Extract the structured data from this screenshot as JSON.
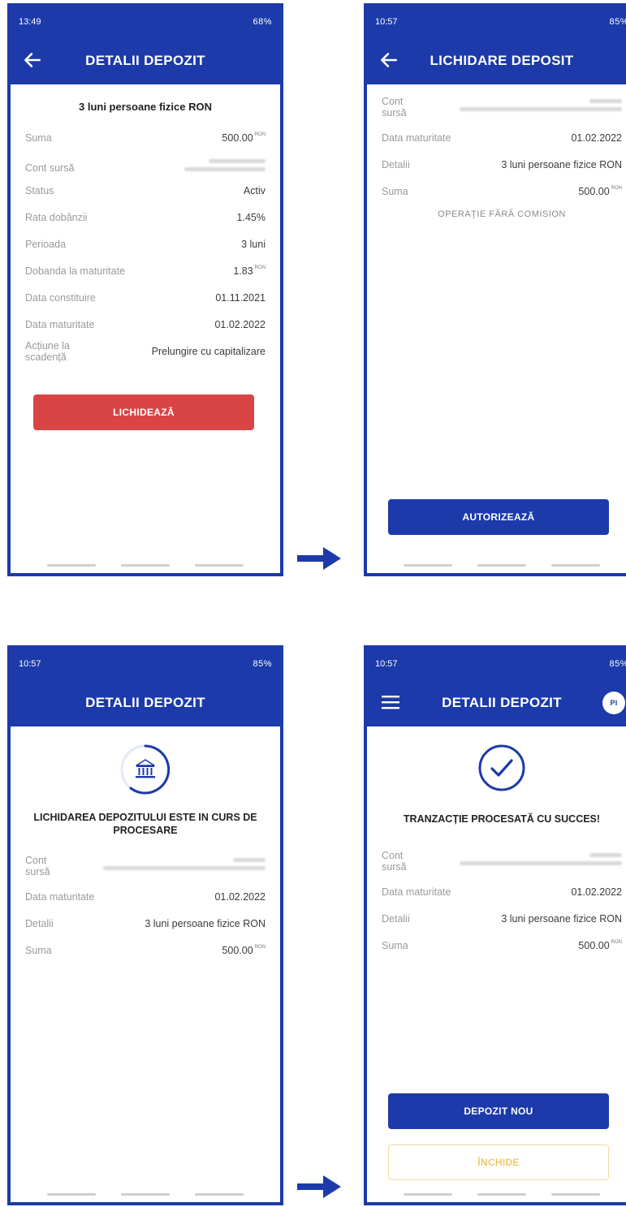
{
  "screen1": {
    "status": {
      "time": "13:49",
      "battery": "68%"
    },
    "header": {
      "title": "DETALII DEPOZIT"
    },
    "product": "3 luni persoane fizice RON",
    "rows": [
      {
        "label": "Suma",
        "value": "500.00",
        "currency": "RON"
      },
      {
        "label": "Cont sursă"
      },
      {
        "label": "Status",
        "value": "Activ"
      },
      {
        "label": "Rata dobânzii",
        "value": "1.45%"
      },
      {
        "label": "Perioada",
        "value": "3 luni"
      },
      {
        "label": "Dobanda la maturitate",
        "value": "1.83",
        "currency": "RON"
      },
      {
        "label": "Data constituire",
        "value": "01.11.2021"
      },
      {
        "label": "Data maturitate",
        "value": "01.02.2022"
      },
      {
        "label": "Acțiune la scadență",
        "value": "Prelungire cu capitalizare"
      }
    ],
    "button": "LICHIDEAZĂ"
  },
  "screen2": {
    "status": {
      "time": "10:57",
      "battery": "85%"
    },
    "header": {
      "title": "LICHIDARE DEPOSIT"
    },
    "rows": [
      {
        "label": "Cont sursă"
      },
      {
        "label": "Data maturitate",
        "value": "01.02.2022"
      },
      {
        "label": "Detalii",
        "value": "3 luni persoane fizice RON"
      },
      {
        "label": "Suma",
        "value": "500.00",
        "currency": "RON"
      }
    ],
    "note": "OPERAȚIE FĂRĂ COMISION",
    "button": "AUTORIZEAZĂ"
  },
  "screen3": {
    "status": {
      "time": "10:57",
      "battery": "85%"
    },
    "header": {
      "title": "DETALII DEPOZIT"
    },
    "heading": "LICHIDAREA DEPOZITULUI ESTE IN CURS DE PROCESARE",
    "rows": [
      {
        "label": "Cont sursă"
      },
      {
        "label": "Data maturitate",
        "value": "01.02.2022"
      },
      {
        "label": "Detalii",
        "value": "3 luni persoane fizice RON"
      },
      {
        "label": "Suma",
        "value": "500.00",
        "currency": "RON"
      }
    ]
  },
  "screen4": {
    "status": {
      "time": "10:57",
      "battery": "85%"
    },
    "header": {
      "title": "DETALII DEPOZIT",
      "avatar": "PI"
    },
    "heading": "TRANZACȚIE PROCESATĂ CU SUCCES!",
    "rows": [
      {
        "label": "Cont sursă"
      },
      {
        "label": "Data maturitate",
        "value": "01.02.2022"
      },
      {
        "label": "Detalii",
        "value": "3 luni persoane fizice RON"
      },
      {
        "label": "Suma",
        "value": "500.00",
        "currency": "RON"
      }
    ],
    "button_primary": "DEPOZIT NOU",
    "button_secondary": "ÎNCHIDE"
  },
  "colors": {
    "brand": "#1c3aa9",
    "danger": "#d94545",
    "outline": "#efc96a"
  }
}
